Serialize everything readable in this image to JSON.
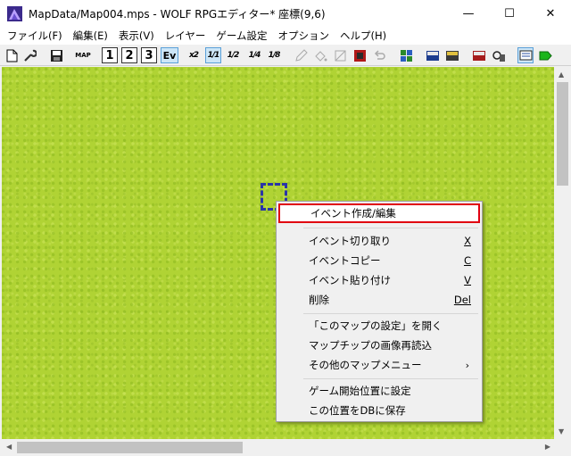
{
  "window": {
    "title": "MapData/Map004.mps - WOLF RPGエディター* 座標(9,6)",
    "minimize_glyph": "—",
    "maximize_glyph": "☐",
    "close_glyph": "✕"
  },
  "menubar": {
    "items": [
      "ファイル(F)",
      "編集(E)",
      "表示(V)",
      "レイヤー",
      "ゲーム設定",
      "オプション",
      "ヘルプ(H)"
    ]
  },
  "toolbar": {
    "layer1": "1",
    "layer2": "2",
    "layer3": "3",
    "event_layer": "Ev",
    "zoom_half": "x2",
    "zoom_1_1": "1/1",
    "zoom_1_2": "1/2",
    "zoom_1_4": "1/4",
    "zoom_1_8": "1/8",
    "map_label": "MAP",
    "icon_names": [
      "new-file-icon",
      "wrench-icon",
      "save-icon",
      "map-icon",
      "layer1-icon",
      "layer2-icon",
      "layer3-icon",
      "event-layer-icon",
      "zoom-2x-icon",
      "zoom-1-1-icon",
      "zoom-1-2-icon",
      "zoom-1-4-icon",
      "zoom-1-8-icon",
      "pencil-icon",
      "bucket-icon",
      "shape-icon",
      "tile-icon",
      "undo-icon",
      "tile-palette-icon",
      "database-icon",
      "common-event-icon",
      "system-db-icon",
      "user-db-icon",
      "game-run-icon",
      "display-toggle-icon",
      "play-icon"
    ]
  },
  "map": {
    "background_color": "#b0d334",
    "cursor_color": "#2a35a8"
  },
  "context_menu": {
    "items": [
      {
        "label": "イベント作成/編集",
        "key": "",
        "highlighted": true
      },
      {
        "label": "イベント切り取り",
        "key": "X"
      },
      {
        "label": "イベントコピー",
        "key": "C"
      },
      {
        "label": "イベント貼り付け",
        "key": "V"
      },
      {
        "label": "削除",
        "key": "Del"
      },
      {
        "label": "「このマップの設定」を開く",
        "key": ""
      },
      {
        "label": "マップチップの画像再読込",
        "key": ""
      },
      {
        "label": "その他のマップメニュー",
        "key": "",
        "submenu_arrow": "›"
      },
      {
        "label": "ゲーム開始位置に設定",
        "key": ""
      },
      {
        "label": "この位置をDBに保存",
        "key": ""
      }
    ],
    "highlight_color": "#e00010"
  },
  "scrollbars": {
    "up_arrow": "▲",
    "down_arrow": "▼",
    "left_arrow": "◀",
    "right_arrow": "▶"
  }
}
